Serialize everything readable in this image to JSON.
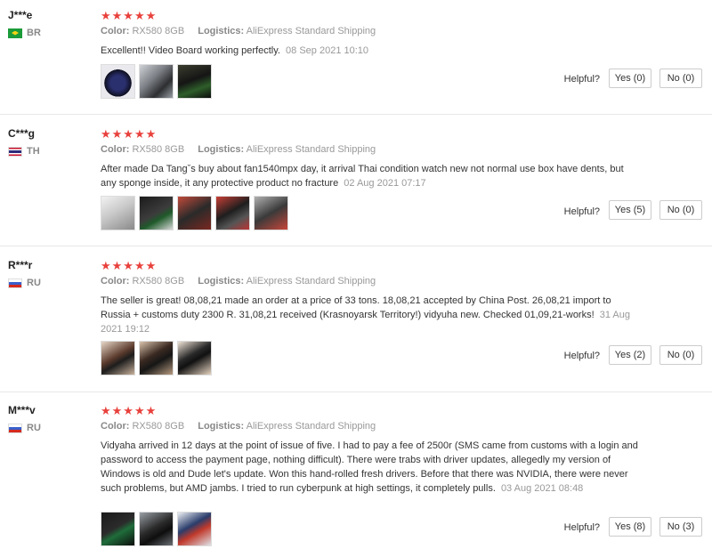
{
  "labels": {
    "color": "Color:",
    "logistics": "Logistics:",
    "helpful": "Helpful?"
  },
  "reviews": [
    {
      "user": "J***e",
      "country": "BR",
      "stars": "★★★★★",
      "color": "RX580 8GB",
      "logistics": "AliExpress Standard Shipping",
      "text": "Excellent!! Video Board working perfectly.",
      "date": "08 Sep 2021 10:10",
      "yes": "Yes (0)",
      "no": "No (0)"
    },
    {
      "user": "C***g",
      "country": "TH",
      "stars": "★★★★★",
      "color": "RX580 8GB",
      "logistics": "AliExpress Standard Shipping",
      "text": "After made Da Tangˇs buy about fan1540mpx day, it arrival Thai condition watch new not normal use box have dents, but any sponge inside, it any protective product no fracture",
      "date": "02 Aug 2021 07:17",
      "yes": "Yes (5)",
      "no": "No (0)"
    },
    {
      "user": "R***r",
      "country": "RU",
      "stars": "★★★★★",
      "color": "RX580 8GB",
      "logistics": "AliExpress Standard Shipping",
      "text": "The seller is great! 08,08,21 made an order at a price of 33 tons. 18,08,21 accepted by China Post. 26,08,21 import to Russia + customs duty 2300 R. 31,08,21 received (Krasnoyarsk Territory!) vidyuha new. Checked 01,09,21-works!",
      "date": "31 Aug 2021 19:12",
      "yes": "Yes (2)",
      "no": "No (0)"
    },
    {
      "user": "M***v",
      "country": "RU",
      "stars": "★★★★★",
      "color": "RX580 8GB",
      "logistics": "AliExpress Standard Shipping",
      "text": "Vidyaha arrived in 12 days at the point of issue of five. I had to pay a fee of 2500r (SMS came from customs with a login and password to access the payment page, nothing difficult). There were trabs with driver updates, allegedly my version of Windows is old and Dude let's update. Won this hand-rolled fresh drivers. Before that there was NVIDIA, there were never such problems, but AMD jambs. I tried to run cyberpunk at high settings, it completely pulls.",
      "date": "03 Aug 2021 08:48",
      "yes": "Yes (8)",
      "no": "No (3)"
    }
  ],
  "colors": {
    "star": "#e8413c",
    "muted": "#999999",
    "divider": "#e8e8e8"
  }
}
